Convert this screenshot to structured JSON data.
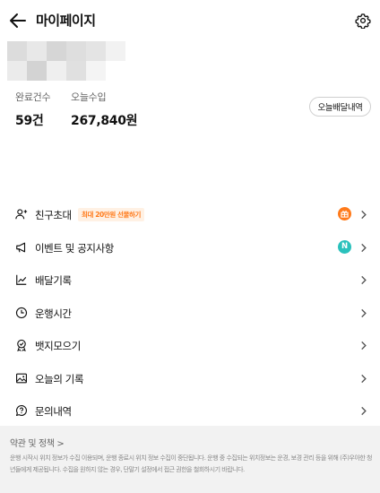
{
  "header": {
    "title": "마이페이지",
    "back_icon": "arrow-left-icon",
    "settings_icon": "gear-icon"
  },
  "profile": {
    "avatar_state": "blurred"
  },
  "stats": {
    "completed_label": "완료건수",
    "completed_value": "59건",
    "income_label": "오늘수입",
    "income_value": "267,840원",
    "deliveries_button": "오늘배달내역"
  },
  "menu": {
    "items": [
      {
        "label": "친구초대",
        "icon": "person-add-icon",
        "badge_text": "최대 20만원 선물하기",
        "indicator": "gift-icon"
      },
      {
        "label": "이벤트 및 공지사항",
        "icon": "megaphone-icon",
        "indicator": "N"
      },
      {
        "label": "배달기록",
        "icon": "line-chart-icon"
      },
      {
        "label": "운행시간",
        "icon": "clock-icon"
      },
      {
        "label": "뱃지모으기",
        "icon": "badge-icon"
      },
      {
        "label": "오늘의 기록",
        "icon": "image-icon"
      },
      {
        "label": "문의내역",
        "icon": "chat-question-icon"
      }
    ]
  },
  "footer": {
    "terms_label": "약관 및 정책 >",
    "notice": "운행 시작시 위치 정보가 수집 이용되며, 운행 종료시 위치 정보 수집이 중단됩니다. 운행 중 수집되는 위치정보는 운경, 보경 관리 등을 위해 (주)우아한 청년들에게 제공됩니다. 수집을 원하지 않는 경우, 단말기 설정에서 접근 권한을 철회하시기 바랍니다."
  },
  "colors": {
    "accent_orange": "#ff7a1a",
    "new_badge_teal": "#2ac1bc",
    "footer_bg": "#f2f2f2"
  }
}
